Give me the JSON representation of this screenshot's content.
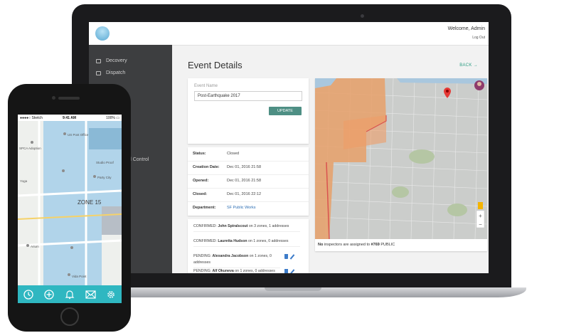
{
  "dashboard": {
    "header": {
      "welcome": "Welcome, Admin",
      "logout": "Log Out"
    },
    "sidebar": {
      "items": [
        {
          "label": "Decovery",
          "icon": "grid-icon"
        },
        {
          "label": "Dispatch",
          "icon": "id-card-icon"
        }
      ],
      "partial_item": "nd Control"
    },
    "page": {
      "title": "Event Details",
      "back": "BACK →"
    },
    "event_form": {
      "label": "Event Name",
      "value": "Post-Earthquake 2017",
      "button": "UPDATE"
    },
    "details": [
      {
        "label": "Status:",
        "value": "Closed"
      },
      {
        "label": "Creation Date:",
        "value": "Dec 01, 2016 21:58"
      },
      {
        "label": "Opened:",
        "value": "Dec 01, 2016 21:58"
      },
      {
        "label": "Closed:",
        "value": "Dec 01, 2016 22:12"
      },
      {
        "label": "Department:",
        "value": "SF Public Works"
      }
    ],
    "log": [
      {
        "status": "CONFIRMED:",
        "name": "John Spiralscout",
        "tail": "on 3 zones, 1 addresses"
      },
      {
        "status": "CONFIRMED:",
        "name": "Lauretta Hudson",
        "tail": "on 1 zones, 0 addresses"
      },
      {
        "status": "PENDING:",
        "name": "Alexandra Jacobson",
        "tail": "on 1 zones, 0 addresses"
      },
      {
        "status": "PENDING:",
        "name": "Alf Okuneva",
        "tail": "on 1 zones, 0 addresses"
      }
    ],
    "map_caption": {
      "prefix": "No",
      "middle": " inspectors are assigned to ",
      "event": "#769",
      "suffix": " PUBLIC"
    }
  },
  "phone": {
    "status": {
      "carrier": "●●●●○ Sketch",
      "time": "9:41 AM",
      "battery": "100% ▭"
    },
    "map_labels": {
      "zone": "ZONE 15",
      "shops": [
        "US Post Office",
        "Studio Proof",
        "SPCA Adoption",
        "Party City",
        "Yoga",
        "Arium",
        "Vida Point"
      ]
    },
    "tabs": [
      "clock-icon",
      "plus-circle-icon",
      "bell-icon",
      "envelope-icon",
      "gear-icon"
    ]
  },
  "colors": {
    "accent_teal": "#2fb7c1",
    "button_green": "#4e8f84",
    "zone_orange": "#e8a06a",
    "zone_blue": "#9ccbe8",
    "sidebar": "#3d3e40"
  }
}
